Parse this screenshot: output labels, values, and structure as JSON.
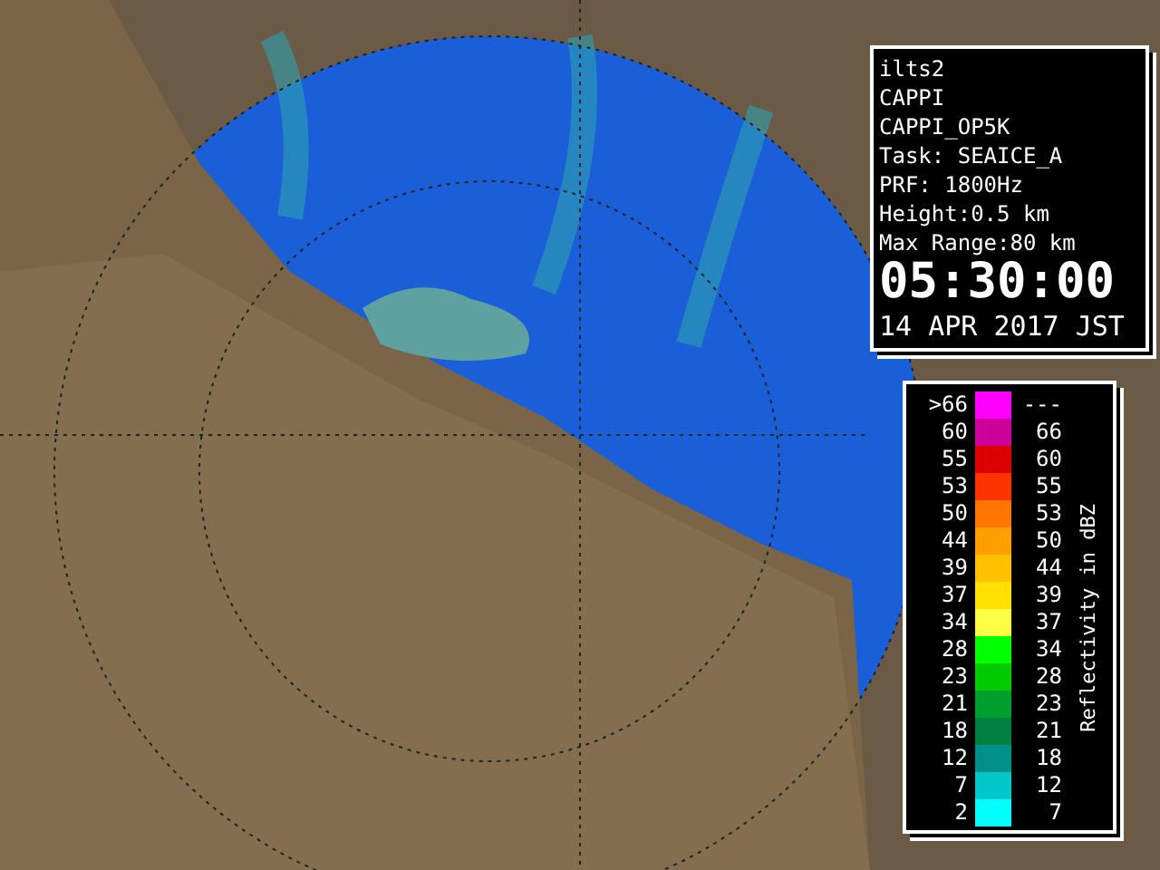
{
  "info_panel": {
    "lines": [
      "ilts2",
      "CAPPI",
      "CAPPI_OP5K",
      "Task: SEAICE_A",
      "PRF: 1800Hz",
      "Height:0.5 km",
      "Max Range:80 km"
    ],
    "time": "05:30:00",
    "date": "14 APR 2017 JST"
  },
  "legend": {
    "title": "Reflectivity in dBZ",
    "rows": [
      {
        "low": ">66",
        "high": "---",
        "color": "#ff00ff"
      },
      {
        "low": "60",
        "high": "66",
        "color": "#cc0099"
      },
      {
        "low": "55",
        "high": "60",
        "color": "#dd0000"
      },
      {
        "low": "53",
        "high": "55",
        "color": "#ff3300"
      },
      {
        "low": "50",
        "high": "53",
        "color": "#ff7700"
      },
      {
        "low": "44",
        "high": "50",
        "color": "#ffa000"
      },
      {
        "low": "39",
        "high": "44",
        "color": "#ffc000"
      },
      {
        "low": "37",
        "high": "39",
        "color": "#ffe000"
      },
      {
        "low": "34",
        "high": "37",
        "color": "#ffff44"
      },
      {
        "low": "28",
        "high": "34",
        "color": "#00ff00"
      },
      {
        "low": "23",
        "high": "28",
        "color": "#00cc00"
      },
      {
        "low": "21",
        "high": "23",
        "color": "#00a030"
      },
      {
        "low": "18",
        "high": "21",
        "color": "#008040"
      },
      {
        "low": "12",
        "high": "18",
        "color": "#00908a"
      },
      {
        "low": "7",
        "high": "12",
        "color": "#00c8c8"
      },
      {
        "low": "2",
        "high": "7",
        "color": "#00ffff"
      }
    ]
  }
}
